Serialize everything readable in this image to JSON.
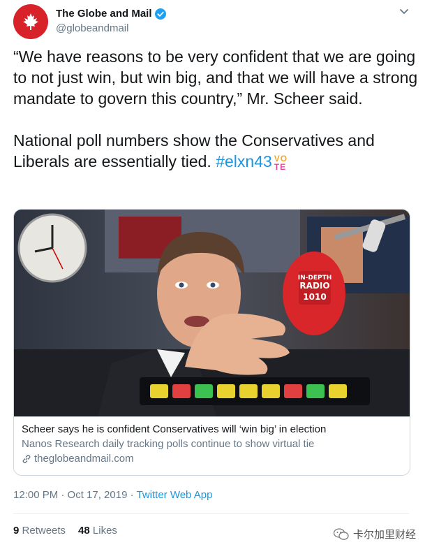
{
  "account": {
    "display_name": "The Globe and Mail",
    "handle": "@globeandmail"
  },
  "tweet": {
    "paragraph1": "“We have reasons to be very confident that we are going to not just win, but win big, and that we will have a strong mandate to govern this country,” Mr. Scheer said.",
    "paragraph2": "National poll numbers show the Conservatives and Liberals are essentially tied.",
    "hashtag": "#elxn43",
    "emoji_top": "VO",
    "emoji_bottom": "TE"
  },
  "card": {
    "image_icons": [
      "clock-icon",
      "microphone-icon"
    ],
    "mic_flag_line1": "IN-DEPTH",
    "mic_flag_line2": "RADIO",
    "mic_flag_line3": "1010",
    "title": "Scheer says he is confident Conservatives will ‘win big’ in election",
    "description": "Nanos Research daily tracking polls continue to show virtual tie",
    "domain": "theglobeandmail.com"
  },
  "meta": {
    "timestamp": "12:00 PM · Oct 17, 2019 · ",
    "source": "Twitter Web App"
  },
  "stats": {
    "retweets_count": "9",
    "retweets_label": "Retweets",
    "likes_count": "48",
    "likes_label": "Likes"
  },
  "watermark": {
    "text": "卡尔加里财经"
  },
  "colors": {
    "link": "#1b95e0",
    "secondary_text": "#657786",
    "avatar_bg": "#d8222a",
    "border": "#ccd6dd"
  }
}
